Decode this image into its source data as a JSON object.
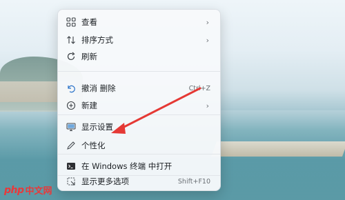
{
  "context_menu": {
    "items": [
      {
        "label": "查看",
        "icon": "grid-icon",
        "has_submenu": true,
        "shortcut": ""
      },
      {
        "label": "排序方式",
        "icon": "sort-icon",
        "has_submenu": true,
        "shortcut": ""
      },
      {
        "label": "刷新",
        "icon": "refresh-icon",
        "has_submenu": false,
        "shortcut": ""
      },
      {
        "label": "撤消 删除",
        "icon": "undo-icon",
        "has_submenu": false,
        "shortcut": "Ctrl+Z"
      },
      {
        "label": "新建",
        "icon": "plus-circle-icon",
        "has_submenu": true,
        "shortcut": ""
      },
      {
        "label": "显示设置",
        "icon": "display-icon",
        "has_submenu": false,
        "shortcut": ""
      },
      {
        "label": "个性化",
        "icon": "pen-icon",
        "has_submenu": false,
        "shortcut": ""
      },
      {
        "label": "在 Windows 终端 中打开",
        "icon": "terminal-icon",
        "has_submenu": false,
        "shortcut": ""
      },
      {
        "label": "显示更多选项",
        "icon": "more-options-icon",
        "has_submenu": false,
        "shortcut": "Shift+F10"
      }
    ]
  },
  "annotation": {
    "arrow_color": "#e53935"
  },
  "watermark": {
    "logo": "php",
    "text": "中文网",
    "color": "#e8393a"
  }
}
